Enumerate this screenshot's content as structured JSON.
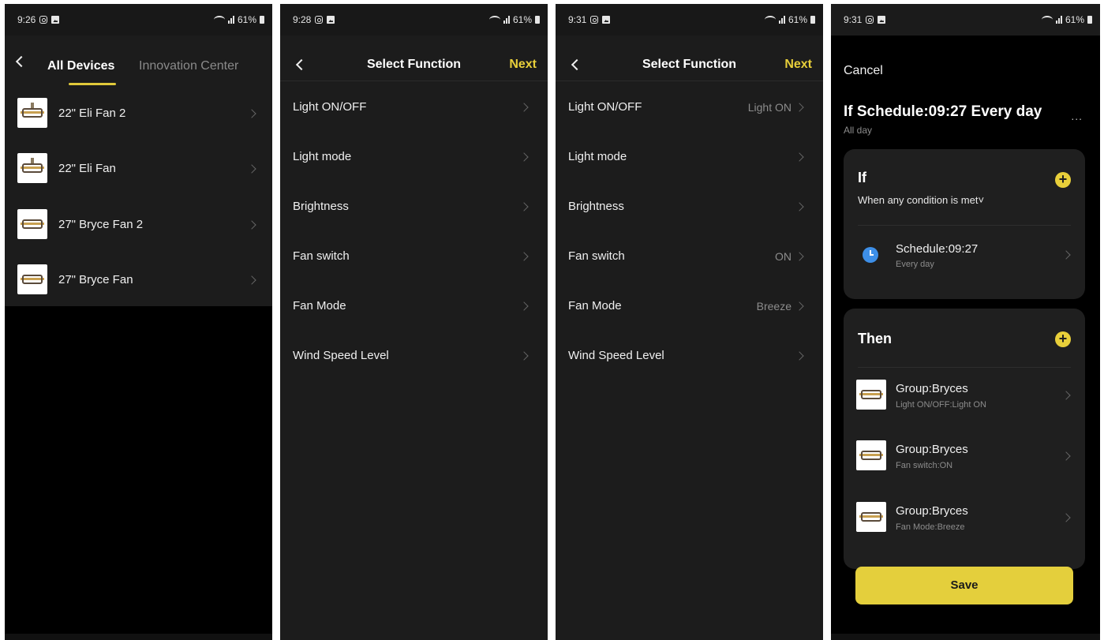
{
  "screen1": {
    "status": {
      "time": "9:26",
      "battery": "61%"
    },
    "tabs": {
      "active": "All Devices",
      "inactive": "Innovation Center"
    },
    "devices": [
      {
        "label": "22\" Eli Fan 2"
      },
      {
        "label": "22\" Eli Fan"
      },
      {
        "label": "27\" Bryce Fan 2"
      },
      {
        "label": "27\" Bryce Fan"
      }
    ]
  },
  "screen2": {
    "status": {
      "time": "9:28",
      "battery": "61%"
    },
    "title": "Select Function",
    "next": "Next",
    "functions": [
      {
        "label": "Light ON/OFF",
        "value": ""
      },
      {
        "label": "Light mode",
        "value": ""
      },
      {
        "label": "Brightness",
        "value": ""
      },
      {
        "label": "Fan switch",
        "value": ""
      },
      {
        "label": "Fan Mode",
        "value": ""
      },
      {
        "label": "Wind Speed Level",
        "value": ""
      }
    ]
  },
  "screen3": {
    "status": {
      "time": "9:31",
      "battery": "61%"
    },
    "title": "Select Function",
    "next": "Next",
    "functions": [
      {
        "label": "Light ON/OFF",
        "value": "Light ON"
      },
      {
        "label": "Light mode",
        "value": ""
      },
      {
        "label": "Brightness",
        "value": ""
      },
      {
        "label": "Fan switch",
        "value": "ON"
      },
      {
        "label": "Fan Mode",
        "value": "Breeze"
      },
      {
        "label": "Wind Speed Level",
        "value": ""
      }
    ]
  },
  "screen4": {
    "status": {
      "time": "9:31",
      "battery": "61%"
    },
    "cancel": "Cancel",
    "title": "If Schedule:09:27 Every day",
    "subtitle": "All day",
    "more": "...",
    "if_card": {
      "heading": "If",
      "condition_mode": "When any condition is met˅",
      "condition": {
        "title": "Schedule:09:27",
        "sub": "Every day"
      }
    },
    "then_card": {
      "heading": "Then",
      "actions": [
        {
          "title": "Group:Bryces",
          "sub": "Light ON/OFF:Light ON"
        },
        {
          "title": "Group:Bryces",
          "sub": "Fan switch:ON"
        },
        {
          "title": "Group:Bryces",
          "sub": "Fan Mode:Breeze"
        }
      ]
    },
    "save": "Save"
  },
  "colors": {
    "accent": "#e4cf3c",
    "background": "#000000",
    "panel": "#1c1c1c",
    "clock": "#3d8fe8"
  }
}
